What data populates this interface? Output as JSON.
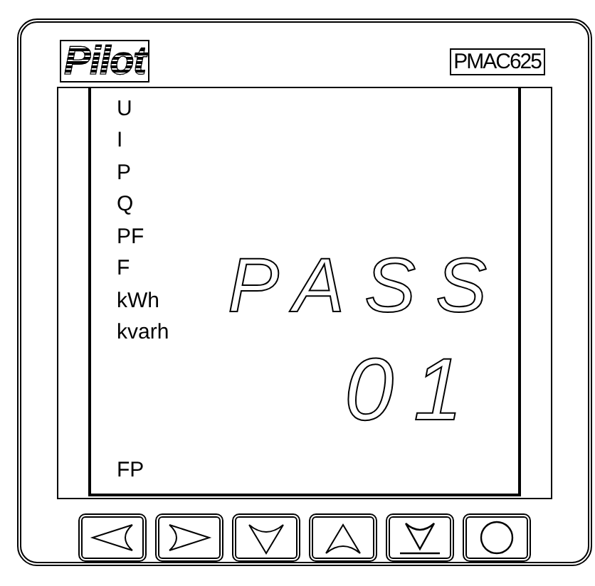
{
  "brand": {
    "logo": "Pilot",
    "model": "PMAC625"
  },
  "display": {
    "indicators": [
      "U",
      "I",
      "P",
      "Q",
      "PF",
      "F",
      "kWh",
      "kvarh"
    ],
    "footer_indicator": "FP",
    "lines": [
      "PASS",
      "01"
    ]
  },
  "buttons": [
    {
      "kind": "left"
    },
    {
      "kind": "right"
    },
    {
      "kind": "down"
    },
    {
      "kind": "up"
    },
    {
      "kind": "enter"
    },
    {
      "kind": "circle"
    }
  ]
}
